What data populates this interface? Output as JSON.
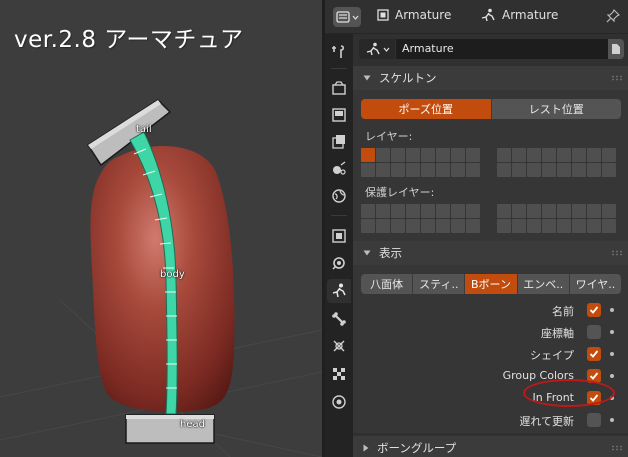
{
  "viewport": {
    "title": "ver.2.8 アーマチュア",
    "bone_labels": {
      "tail": "tail",
      "body": "body",
      "head": "head"
    }
  },
  "header": {
    "object_name": "Armature",
    "data_name": "Armature",
    "icons": [
      "editor-type-icon",
      "object-icon",
      "armature-data-icon",
      "pin-icon"
    ]
  },
  "tabs": [
    "tool-tab",
    "render-tab",
    "output-tab",
    "view-layer-tab",
    "scene-tab",
    "world-tab",
    "object-tab",
    "modifier-tab",
    "armature-data-tab",
    "bone-tab",
    "bone-constraint-tab",
    "texture-tab",
    "physics-tab"
  ],
  "datablock": {
    "name": "Armature"
  },
  "skeleton_panel": {
    "title": "スケルトン",
    "pose_position": "ポーズ位置",
    "rest_position": "レスト位置",
    "layers_label": "レイヤー:",
    "protected_layers_label": "保護レイヤー:",
    "active_layer_index": 0
  },
  "display_panel": {
    "title": "表示",
    "display_types": [
      "八面体",
      "スティ..",
      "Bボーン",
      "エンベ..",
      "ワイヤ.."
    ],
    "active_display_type": "Bボーン",
    "options": [
      {
        "label": "名前",
        "checked": true
      },
      {
        "label": "座標軸",
        "checked": false
      },
      {
        "label": "シェイプ",
        "checked": true
      },
      {
        "label": "Group Colors",
        "checked": true
      },
      {
        "label": "In Front",
        "checked": true
      },
      {
        "label": "遅れて更新",
        "checked": false
      }
    ]
  },
  "bone_groups_panel": {
    "title": "ボーングループ"
  },
  "colors": {
    "accent": "#c24c0e",
    "bone_selected": "#3ed6a6",
    "mesh_red": "#a04235",
    "highlight_ellipse": "#c01818"
  }
}
